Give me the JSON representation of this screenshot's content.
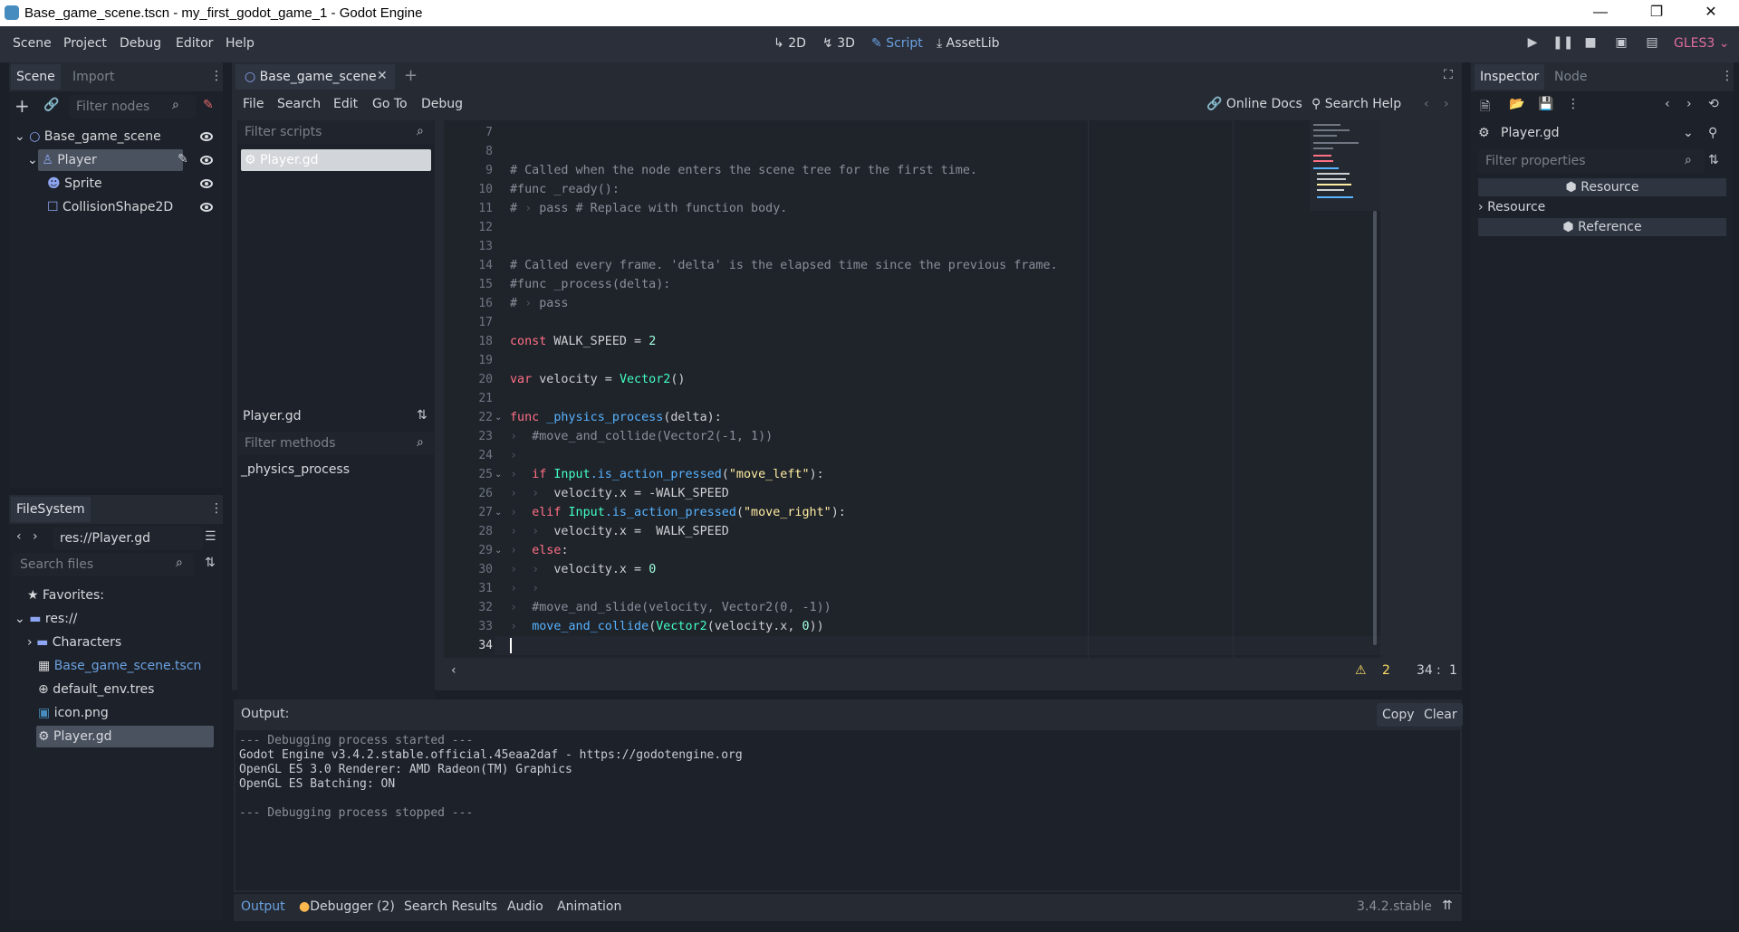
{
  "window": {
    "title": "Base_game_scene.tscn - my_first_godot_game_1 - Godot Engine",
    "minimize": "—",
    "restore": "❐",
    "close": "✕"
  },
  "menubar": {
    "items": [
      "Scene",
      "Project",
      "Debug",
      "Editor",
      "Help"
    ],
    "workspaces": [
      "2D",
      "3D",
      "Script",
      "AssetLib"
    ],
    "active_workspace": "Script",
    "renderer": "GLES3",
    "accent": "#6aa1e0",
    "renderer_color": "#e06c9f"
  },
  "scene_dock": {
    "tabs": [
      "Scene",
      "Import"
    ],
    "filter_placeholder": "Filter nodes",
    "nodes": [
      {
        "name": "Base_game_scene",
        "icon": "node2d-icon"
      },
      {
        "name": "Player",
        "icon": "kinematic-body-icon",
        "selected": true
      },
      {
        "name": "Sprite",
        "icon": "sprite-icon"
      },
      {
        "name": "CollisionShape2D",
        "icon": "collision-shape-icon"
      }
    ]
  },
  "filesystem_dock": {
    "title": "FileSystem",
    "path": "res://Player.gd",
    "search_placeholder": "Search files",
    "favorites": "Favorites:",
    "root": "res://",
    "items": [
      {
        "name": "Characters",
        "icon": "folder-icon"
      },
      {
        "name": "Base_game_scene.tscn",
        "icon": "scene-icon",
        "highlight": true
      },
      {
        "name": "default_env.tres",
        "icon": "environment-icon"
      },
      {
        "name": "icon.png",
        "icon": "image-icon"
      },
      {
        "name": "Player.gd",
        "icon": "gear-icon",
        "selected": true
      }
    ]
  },
  "script_editor": {
    "tab": "Base_game_scene",
    "menus": [
      "File",
      "Search",
      "Edit",
      "Go To",
      "Debug"
    ],
    "online_docs": "Online Docs",
    "search_help": "Search Help",
    "filter_scripts": "Filter scripts",
    "scripts": [
      "Player.gd"
    ],
    "current_script": "Player.gd",
    "filter_methods": "Filter methods",
    "methods": [
      "_physics_process"
    ],
    "warnings": "2",
    "line": "34",
    "col": "1",
    "line_numbers": [
      "7",
      "8",
      "9",
      "10",
      "11",
      "12",
      "13",
      "14",
      "15",
      "16",
      "17",
      "18",
      "19",
      "20",
      "21",
      "22",
      "23",
      "24",
      "25",
      "26",
      "27",
      "28",
      "29",
      "30",
      "31",
      "32",
      "33",
      "34"
    ],
    "lines": {
      "l9": "# Called when the node enters the scene tree for the first time.",
      "l10": "#func _ready():",
      "l11a": "#",
      "l11b": "pass # Replace with function body.",
      "l14": "# Called every frame. 'delta' is the elapsed time since the previous frame.",
      "l15": "#func _process(delta):",
      "l16a": "#",
      "l16b": "pass",
      "l18a": "const",
      "l18b": " WALK_SPEED = ",
      "l18c": "2",
      "l20a": "var",
      "l20b": " velocity = ",
      "l20c": "Vector2",
      "l20d": "()",
      "l22a": "func",
      "l22b": " _physics_process",
      "l22c": "(delta):",
      "l23": "#move_and_collide(Vector2(-1, 1))",
      "l25a": "if",
      "l25b": " Input",
      "l25c": ".is_action_pressed",
      "l25d": "(",
      "l25e": "\"move_left\"",
      "l25f": "):",
      "l26a": "velocity.x = -WALK_SPEED",
      "l27a": "elif",
      "l27b": " Input",
      "l27c": ".is_action_pressed",
      "l27d": "(",
      "l27e": "\"move_right\"",
      "l27f": "):",
      "l28a": "velocity.x =  WALK_SPEED",
      "l29a": "else",
      "l29b": ":",
      "l30a": "velocity.x = ",
      "l30b": "0",
      "l32": "#move_and_slide(velocity, Vector2(0, -1))",
      "l33a": "move_and_collide",
      "l33b": "(",
      "l33c": "Vector2",
      "l33d": "(velocity.x, ",
      "l33e": "0",
      "l33f": "))"
    }
  },
  "output": {
    "title": "Output:",
    "copy": "Copy",
    "clear": "Clear",
    "log": [
      "--- Debugging process started ---",
      "Godot Engine v3.4.2.stable.official.45eaa2daf - https://godotengine.org",
      "OpenGL ES 3.0 Renderer: AMD Radeon(TM) Graphics",
      "OpenGL ES Batching: ON",
      "",
      "--- Debugging process stopped ---"
    ]
  },
  "bottom_bar": {
    "tabs": [
      "Output",
      "Debugger (2)",
      "Search Results",
      "Audio",
      "Animation"
    ],
    "version": "3.4.2.stable"
  },
  "inspector": {
    "tabs": [
      "Inspector",
      "Node"
    ],
    "object": "Player.gd",
    "filter_placeholder": "Filter properties",
    "sections": [
      "Resource",
      "Resource",
      "Reference"
    ]
  }
}
